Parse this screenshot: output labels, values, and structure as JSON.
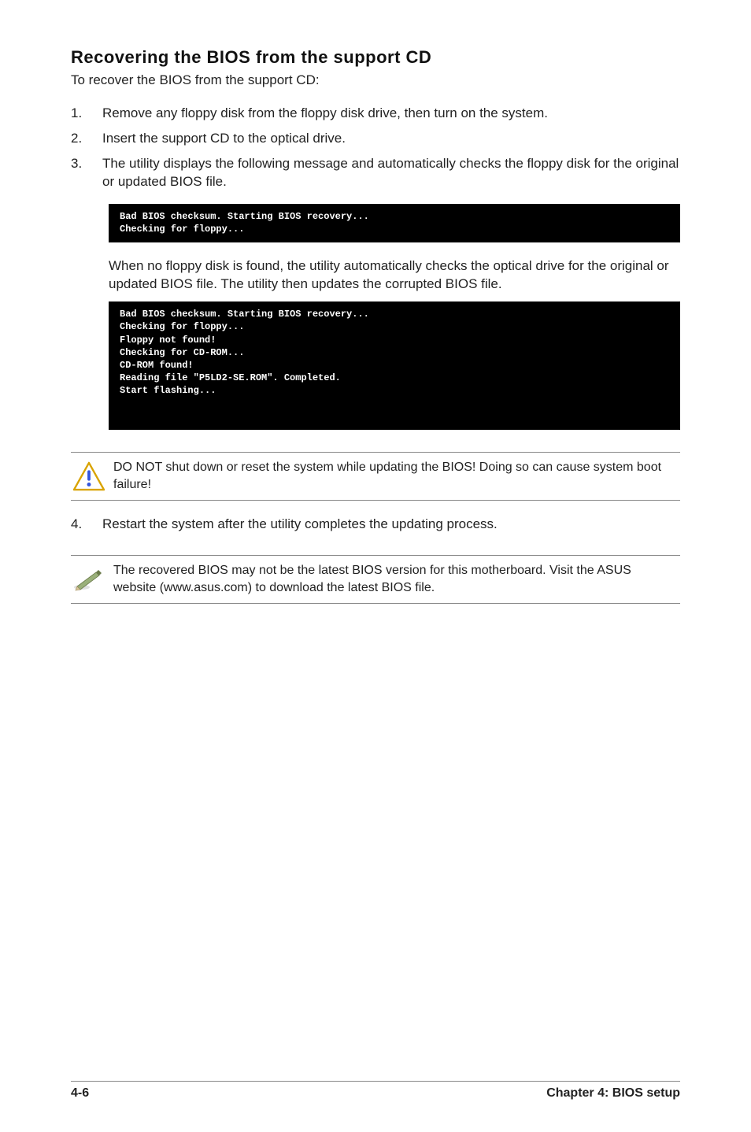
{
  "heading": "Recovering the BIOS from the support CD",
  "intro": "To recover the BIOS from the support CD:",
  "steps": {
    "s1": {
      "n": "1.",
      "text": "Remove any floppy disk from the floppy disk drive, then turn on the system."
    },
    "s2": {
      "n": "2.",
      "text": "Insert the support CD to the optical drive."
    },
    "s3": {
      "n": "3.",
      "text": "The utility displays the following message and automatically checks the floppy disk for the original or updated BIOS file."
    },
    "s4": {
      "n": "4.",
      "text": "Restart the system after the utility completes the updating process."
    }
  },
  "terminal1": "Bad BIOS checksum. Starting BIOS recovery...\nChecking for floppy...",
  "followup1": "When no floppy disk is found, the utility automatically checks the optical drive for the original or updated BIOS file. The utility then updates the corrupted BIOS file.",
  "terminal2": "Bad BIOS checksum. Starting BIOS recovery...\nChecking for floppy...\nFloppy not found!\nChecking for CD-ROM...\nCD-ROM found!\nReading file \"P5LD2-SE.ROM\". Completed.\nStart flashing...",
  "caution_text": "DO NOT shut down or reset the system while updating the BIOS! Doing so can cause system boot failure!",
  "note_text": "The recovered BIOS may not be the latest BIOS version for this motherboard. Visit the ASUS website (www.asus.com) to download the latest BIOS file.",
  "footer": {
    "left": "4-6",
    "right": "Chapter 4: BIOS setup"
  }
}
